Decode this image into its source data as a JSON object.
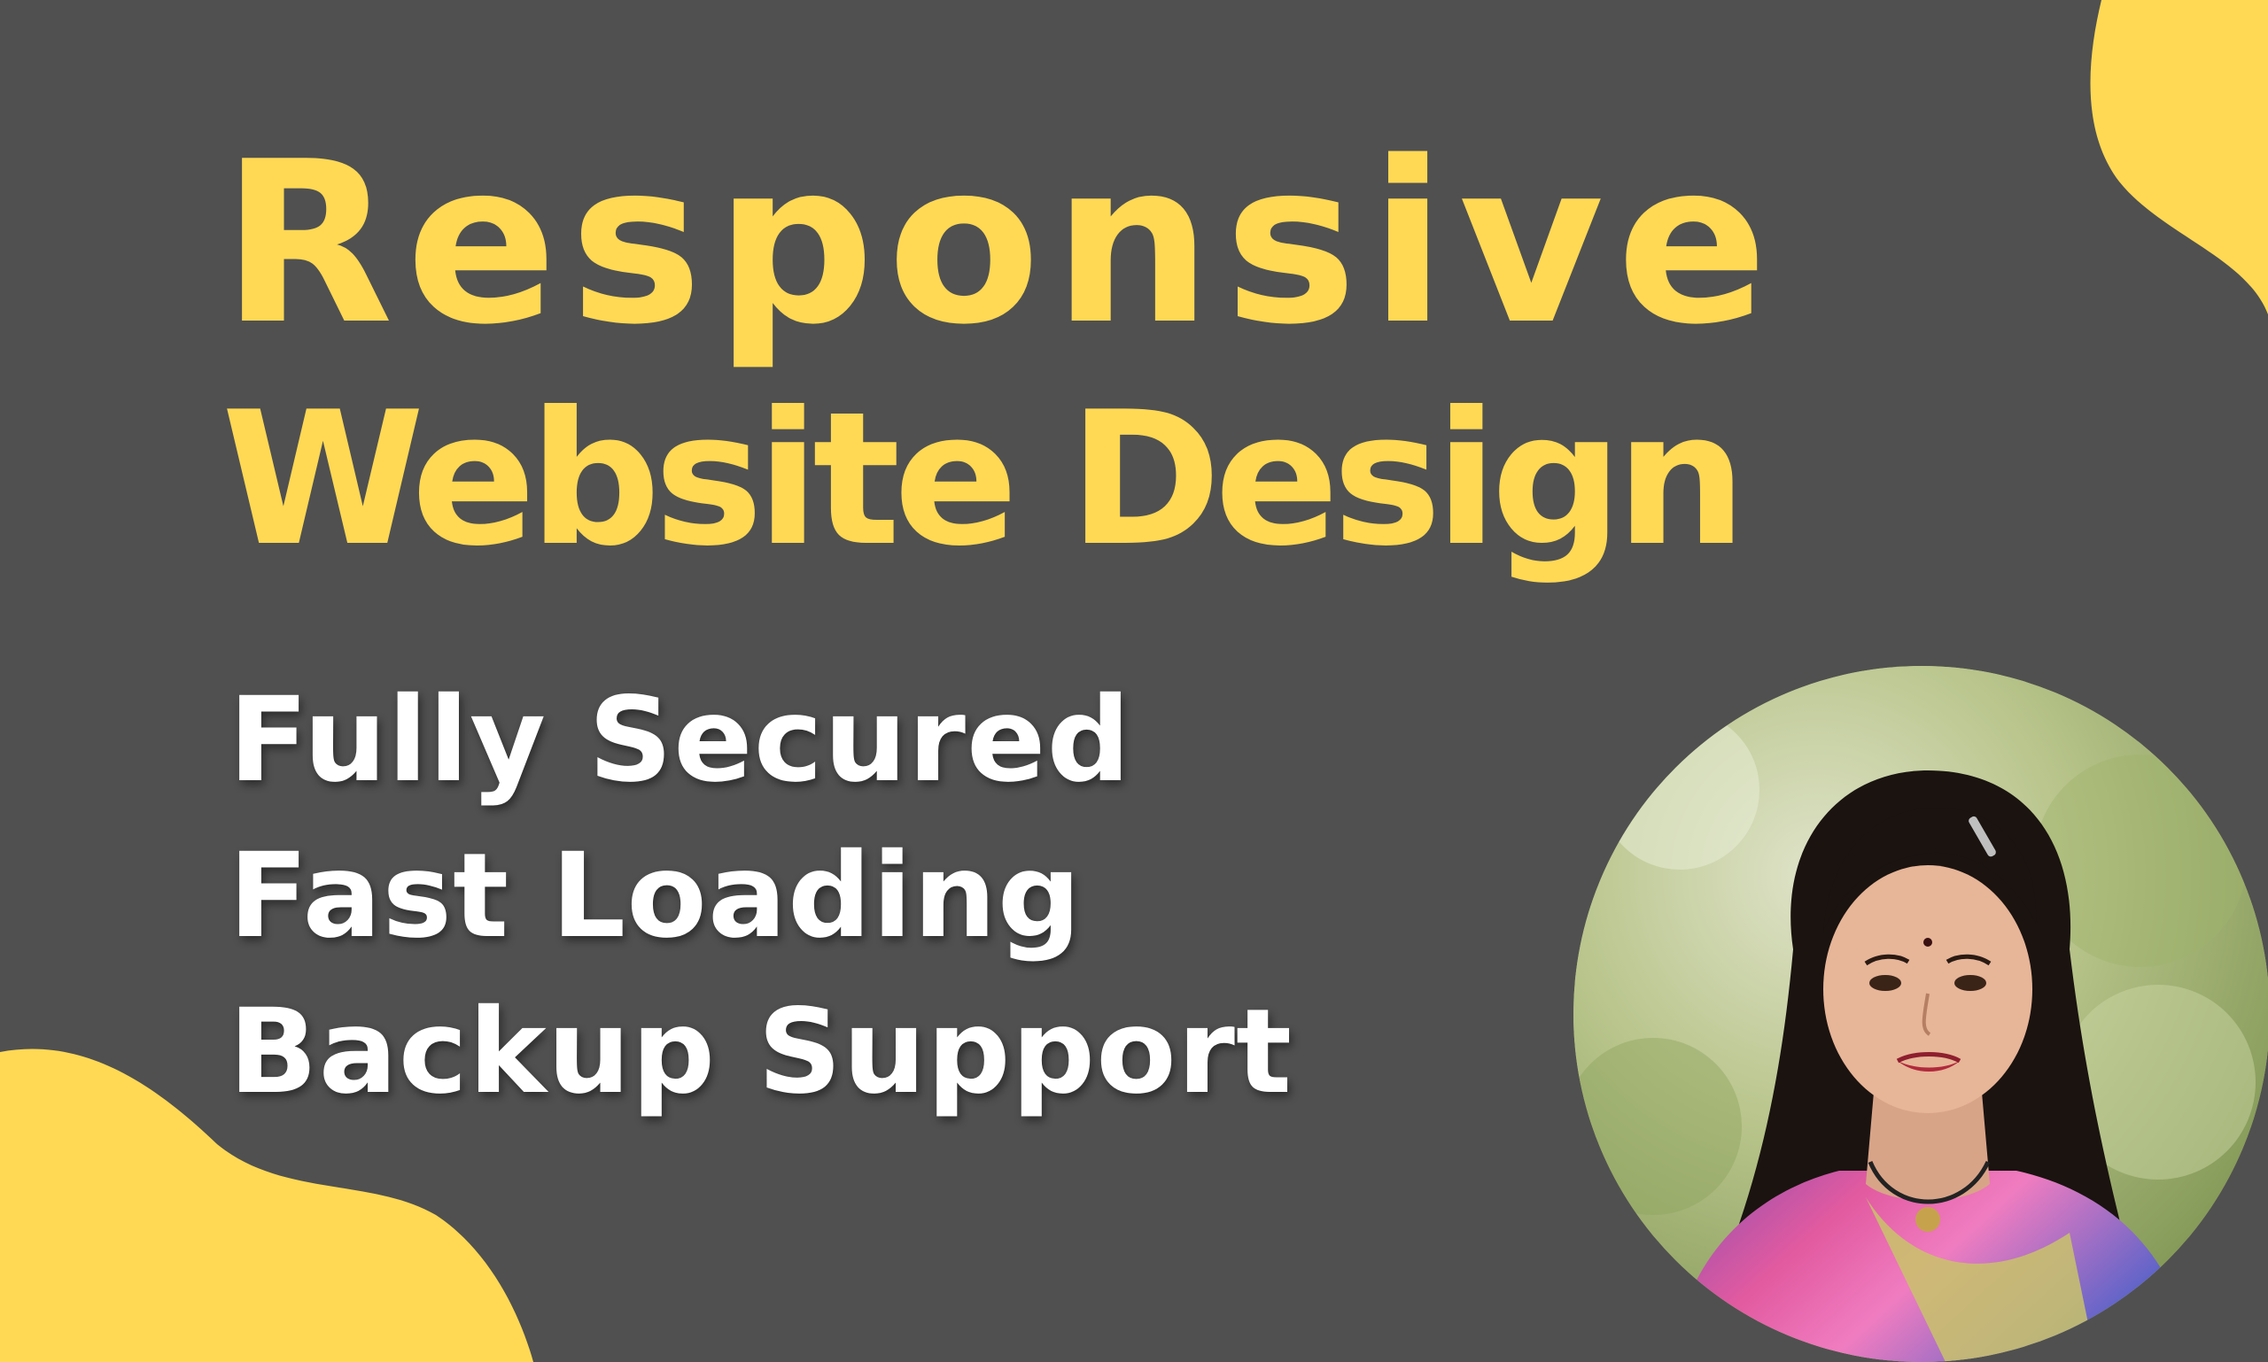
{
  "colors": {
    "background": "#505050",
    "accent": "#FFD954",
    "feature_text": "#FFFFFF"
  },
  "headline": {
    "line1": "Responsive",
    "line2": "Website Design"
  },
  "features": [
    "Fully Secured",
    "Fast Loading",
    "Backup Support"
  ],
  "portrait": {
    "icon": "person-photo"
  }
}
